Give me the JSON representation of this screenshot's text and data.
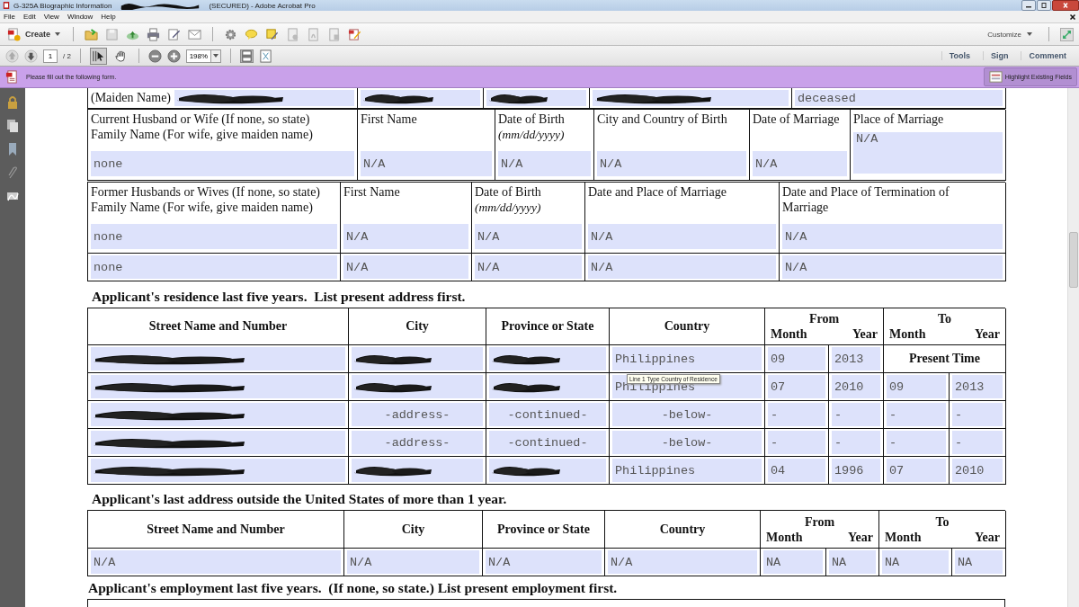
{
  "window": {
    "title": "G-325A Biographic Information",
    "title_redacted": true,
    "title_suffix": "(SECURED) - Adobe Acrobat Pro"
  },
  "menu": [
    "File",
    "Edit",
    "View",
    "Window",
    "Help"
  ],
  "toolbar": {
    "create": "Create",
    "customize": "Customize"
  },
  "navigation": {
    "page": "1",
    "page_total": "/ 2",
    "zoom": "198%",
    "tools": [
      {
        "kind": "select",
        "selected": true
      },
      {
        "kind": "hand",
        "selected": false
      }
    ]
  },
  "panels": [
    "Tools",
    "Sign",
    "Comment"
  ],
  "form_bar": {
    "message": "Please fill out the following form.",
    "button": "Highlight Existing Fields"
  },
  "sections": [
    {
      "kind": "table",
      "rows": [
        [
          {
            "kind": "inline",
            "label": "(Maiden Name)",
            "redacted": true
          },
          {
            "kind": "field",
            "redacted": true
          },
          {
            "kind": "field",
            "redacted": true
          },
          {
            "kind": "field",
            "redacted": true
          },
          {
            "kind": "field",
            "value": "deceased"
          }
        ]
      ]
    },
    {
      "kind": "table",
      "rows": [
        [
          {
            "kind": "labeled",
            "label": "Current Husband or Wife (If none, so state)\nFamily Name (For wife, give maiden name)",
            "value": "none"
          },
          {
            "kind": "labeled",
            "label": "First Name",
            "value": "N/A"
          },
          {
            "kind": "labeled",
            "label": "Date of Birth",
            "note": "(mm/dd/yyyy)",
            "value": "N/A"
          },
          {
            "kind": "labeled",
            "label": "City and Country of Birth",
            "value": "N/A"
          },
          {
            "kind": "labeled",
            "label": "Date of Marriage",
            "value": "N/A"
          },
          {
            "kind": "labeled",
            "label": "Place of Marriage",
            "value": "N/A",
            "multiline": true
          }
        ]
      ]
    },
    {
      "kind": "table",
      "rows": [
        [
          {
            "kind": "labeled",
            "label": "Former Husbands or Wives (If none, so state)\nFamily Name (For wife, give maiden name)",
            "value": "none"
          },
          {
            "kind": "labeled",
            "label": "First Name",
            "value": "N/A"
          },
          {
            "kind": "labeled",
            "label": "Date of Birth",
            "note": "(mm/dd/yyyy)",
            "value": "N/A"
          },
          {
            "kind": "labeled",
            "label": "Date and Place of Marriage",
            "value": "N/A"
          },
          {
            "kind": "labeled",
            "label": "Date and Place of Termination of\nMarriage",
            "value": "N/A"
          }
        ],
        [
          {
            "kind": "field",
            "value": "none"
          },
          {
            "kind": "field",
            "value": "N/A"
          },
          {
            "kind": "field",
            "value": "N/A"
          },
          {
            "kind": "field",
            "value": "N/A"
          },
          {
            "kind": "field",
            "value": "N/A"
          }
        ]
      ]
    },
    {
      "kind": "heading",
      "text": "Applicant's residence last five years.  List present address first."
    },
    {
      "kind": "table",
      "rows": [
        [
          {
            "kind": "header",
            "text": "Street Name and Number"
          },
          {
            "kind": "header",
            "text": "City"
          },
          {
            "kind": "header",
            "text": "Province or State"
          },
          {
            "kind": "header",
            "text": "Country"
          },
          {
            "kind": "span_header",
            "text": "From",
            "sub": [
              "Month",
              "Year"
            ]
          },
          "",
          {
            "kind": "span_header",
            "text": "To",
            "sub": [
              "Month",
              "Year"
            ]
          },
          ""
        ],
        [
          {
            "kind": "field",
            "redacted": true
          },
          {
            "kind": "field",
            "redacted": true
          },
          {
            "kind": "field",
            "redacted": true
          },
          {
            "kind": "field",
            "value": "Philippines"
          },
          {
            "kind": "field",
            "value": "09"
          },
          {
            "kind": "field",
            "value": "2013"
          },
          {
            "kind": "wide_text",
            "text": "Present Time"
          },
          ""
        ],
        [
          {
            "kind": "field",
            "redacted": true
          },
          {
            "kind": "field",
            "redacted": true
          },
          {
            "kind": "field",
            "redacted": true
          },
          {
            "kind": "field",
            "value": "Philippines"
          },
          {
            "kind": "field",
            "value": "07"
          },
          {
            "kind": "field",
            "value": "2010"
          },
          {
            "kind": "field",
            "value": "09"
          },
          {
            "kind": "field",
            "value": "2013"
          }
        ],
        [
          {
            "kind": "field",
            "redacted": true
          },
          {
            "kind": "field",
            "value": "-address-",
            "centered": true
          },
          {
            "kind": "field",
            "value": "-continued-",
            "centered": true
          },
          {
            "kind": "field",
            "value": "-below-",
            "centered": true
          },
          {
            "kind": "field",
            "value": "-"
          },
          {
            "kind": "field",
            "value": "-"
          },
          {
            "kind": "field",
            "value": "-"
          },
          {
            "kind": "field",
            "value": "-"
          }
        ],
        [
          {
            "kind": "field",
            "redacted": true
          },
          {
            "kind": "field",
            "value": "-address-",
            "centered": true
          },
          {
            "kind": "field",
            "value": "-continued-",
            "centered": true
          },
          {
            "kind": "field",
            "value": "-below-",
            "centered": true
          },
          {
            "kind": "field",
            "value": "-"
          },
          {
            "kind": "field",
            "value": "-"
          },
          {
            "kind": "field",
            "value": "-"
          },
          {
            "kind": "field",
            "value": "-"
          }
        ],
        [
          {
            "kind": "field",
            "redacted": true
          },
          {
            "kind": "field",
            "redacted": true
          },
          {
            "kind": "field",
            "redacted": true
          },
          {
            "kind": "field",
            "value": "Philippines"
          },
          {
            "kind": "field",
            "value": "04"
          },
          {
            "kind": "field",
            "value": "1996"
          },
          {
            "kind": "field",
            "value": "07"
          },
          {
            "kind": "field",
            "value": "2010"
          }
        ]
      ]
    },
    {
      "kind": "heading",
      "text": "Applicant's last address outside the United States of more than 1 year."
    },
    {
      "kind": "table",
      "rows": [
        [
          {
            "kind": "header",
            "text": "Street Name and Number"
          },
          {
            "kind": "header",
            "text": "City"
          },
          {
            "kind": "header",
            "text": "Province or State"
          },
          {
            "kind": "header",
            "text": "Country"
          },
          {
            "kind": "span_header",
            "text": "From",
            "sub": [
              "Month",
              "Year"
            ]
          },
          "",
          {
            "kind": "span_header",
            "text": "To",
            "sub": [
              "Month",
              "Year"
            ]
          },
          ""
        ],
        [
          {
            "kind": "field",
            "value": "N/A"
          },
          {
            "kind": "field",
            "value": "N/A"
          },
          {
            "kind": "field",
            "value": "N/A"
          },
          {
            "kind": "field",
            "value": "N/A"
          },
          {
            "kind": "field",
            "value": "NA"
          },
          {
            "kind": "field",
            "value": "NA"
          },
          {
            "kind": "field",
            "value": "NA"
          },
          {
            "kind": "field",
            "value": "NA"
          }
        ]
      ]
    },
    {
      "kind": "heading",
      "text": "Applicant's employment last five years.  (If none, so state.) List present employment first."
    },
    {
      "kind": "table_edge"
    }
  ],
  "tooltip": "Line 1 Type Country of Residence"
}
